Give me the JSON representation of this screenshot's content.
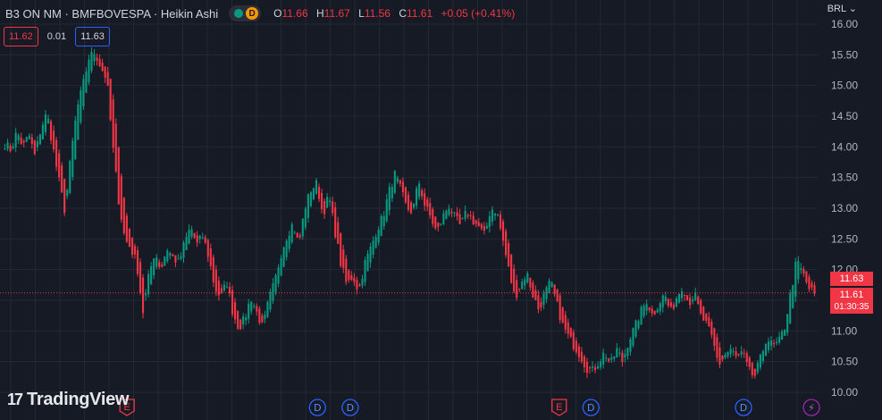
{
  "header": {
    "symbol": "B3 ON NM · BMFBOVESPA · Heikin Ashi",
    "badge_icon": "d-badge-icon",
    "ohlc": {
      "o_label": "O",
      "o": "11.66",
      "h_label": "H",
      "h": "11.67",
      "l_label": "L",
      "l": "11.56",
      "c_label": "C",
      "c": "11.61",
      "change": "+0.05 (+0.41%)"
    },
    "bid": "11.62",
    "spread": "0.01",
    "ask": "11.63",
    "currency": "BRL"
  },
  "price_tags": {
    "ask": "11.63",
    "last": "11.61",
    "countdown": "01:30:35"
  },
  "logo": {
    "text": "TradingView"
  },
  "colors": {
    "up": "#089981",
    "down": "#f23645",
    "bg": "#161a25",
    "grid": "#242833",
    "dividend": "#2962ff",
    "earnings": "#f23645",
    "split": "#9c27b0"
  },
  "chart_data": {
    "type": "candlestick",
    "style": "Heikin Ashi",
    "ylim": [
      10.0,
      16.0
    ],
    "y_ticks": [
      "10.00",
      "10.50",
      "11.00",
      "11.50",
      "12.00",
      "12.50",
      "13.00",
      "13.50",
      "14.00",
      "14.50",
      "15.00",
      "15.50",
      "16.00"
    ],
    "last_price": 11.61,
    "path": [
      14.05,
      13.95,
      14.25,
      14.0,
      14.2,
      13.85,
      14.3,
      14.55,
      14.0,
      13.45,
      12.95,
      13.85,
      14.6,
      15.0,
      15.45,
      15.55,
      15.3,
      15.1,
      14.0,
      13.1,
      12.5,
      12.35,
      12.1,
      11.3,
      11.9,
      12.3,
      12.0,
      12.35,
      12.2,
      12.1,
      12.45,
      12.7,
      12.4,
      12.55,
      12.2,
      11.7,
      11.55,
      11.8,
      11.3,
      11.05,
      11.2,
      11.55,
      11.3,
      11.05,
      11.5,
      11.8,
      12.25,
      12.55,
      12.75,
      12.4,
      13.0,
      13.3,
      13.4,
      12.9,
      13.2,
      12.65,
      12.1,
      11.75,
      11.9,
      11.65,
      12.1,
      12.35,
      12.65,
      12.85,
      13.25,
      13.55,
      13.3,
      13.0,
      12.95,
      13.45,
      13.05,
      12.85,
      12.6,
      12.85,
      13.05,
      12.85,
      12.7,
      12.95,
      12.8,
      12.7,
      12.55,
      13.0,
      12.95,
      12.5,
      12.0,
      11.55,
      11.75,
      11.95,
      11.6,
      11.35,
      11.6,
      11.8,
      11.45,
      11.1,
      10.9,
      10.75,
      10.6,
      10.4,
      10.35,
      10.5,
      10.65,
      10.45,
      10.7,
      10.5,
      10.85,
      11.05,
      11.3,
      11.5,
      11.25,
      11.45,
      11.6,
      11.3,
      11.55,
      11.75,
      11.45,
      11.6,
      11.25,
      11.1,
      10.85,
      10.45,
      10.6,
      10.7,
      10.55,
      10.65,
      10.35,
      10.25,
      10.55,
      10.9,
      10.75,
      10.8,
      11.05,
      11.6,
      12.15,
      11.95,
      11.7,
      11.61
    ],
    "reference_line": 11.62,
    "events": [
      {
        "type": "earnings",
        "label": "E",
        "x_frac": 0.144
      },
      {
        "type": "dividend",
        "label": "D",
        "x_frac": 0.36
      },
      {
        "type": "dividend",
        "label": "D",
        "x_frac": 0.397
      },
      {
        "type": "earnings",
        "label": "E",
        "x_frac": 0.634
      },
      {
        "type": "dividend",
        "label": "D",
        "x_frac": 0.67
      },
      {
        "type": "dividend",
        "label": "D",
        "x_frac": 0.843
      },
      {
        "type": "split",
        "label": "⚡",
        "x_frac": 0.92
      }
    ]
  }
}
